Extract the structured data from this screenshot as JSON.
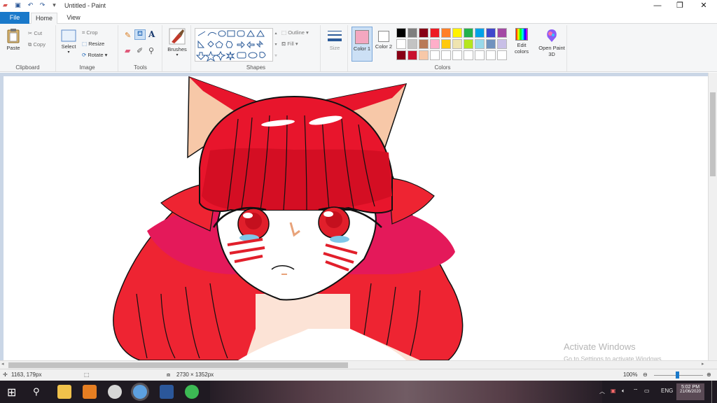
{
  "window": {
    "title": "Untitled - Paint",
    "qat_chevron": "▾"
  },
  "tabs": [
    {
      "label": "File"
    },
    {
      "label": "Home"
    },
    {
      "label": "View"
    }
  ],
  "clipboard": {
    "paste": "Paste",
    "cut": "Cut",
    "copy": "Copy",
    "group": "Clipboard"
  },
  "image": {
    "select": "Select",
    "crop": "Crop",
    "resize": "Resize",
    "rotate": "Rotate",
    "group": "Image"
  },
  "tools": {
    "group": "Tools"
  },
  "brushes": {
    "label": "Brushes"
  },
  "shapes": {
    "outline": "Outline",
    "fill": "Fill",
    "group": "Shapes"
  },
  "size": {
    "label": "Size"
  },
  "colors": {
    "color1": "Color 1",
    "color2": "Color 2",
    "edit": "Edit colors",
    "group": "Colors",
    "color1_value": "#f4a7c0",
    "color2_value": "#ffffff",
    "palette_row1": [
      "#000000",
      "#7f7f7f",
      "#880015",
      "#ed1c24",
      "#ff7f27",
      "#fff200",
      "#22b14c",
      "#00a2e8",
      "#3f48cc",
      "#a349a4"
    ],
    "palette_row2": [
      "#ffffff",
      "#c3c3c3",
      "#b97a57",
      "#ffaec9",
      "#ffc90e",
      "#efe4b0",
      "#b5e61d",
      "#99d9ea",
      "#7092be",
      "#c8bfe7"
    ],
    "palette_row3": [
      "#880015",
      "#c8102e",
      "#f7c8a8",
      "#ffffff",
      "#ffffff",
      "#ffffff",
      "#ffffff",
      "#ffffff",
      "#ffffff",
      "#ffffff"
    ]
  },
  "paint3d": {
    "label": "Open Paint 3D"
  },
  "watermark": {
    "line1": "Activate Windows",
    "line2": "Go to Settings to activate Windows."
  },
  "status": {
    "cursor": "1163, 179px",
    "dimensions": "2730 × 1352px",
    "zoom": "100%"
  },
  "tray": {
    "lang": "ENG",
    "time": "5:02 PM",
    "date": "21/06/2020"
  },
  "accent": "#1979ca"
}
